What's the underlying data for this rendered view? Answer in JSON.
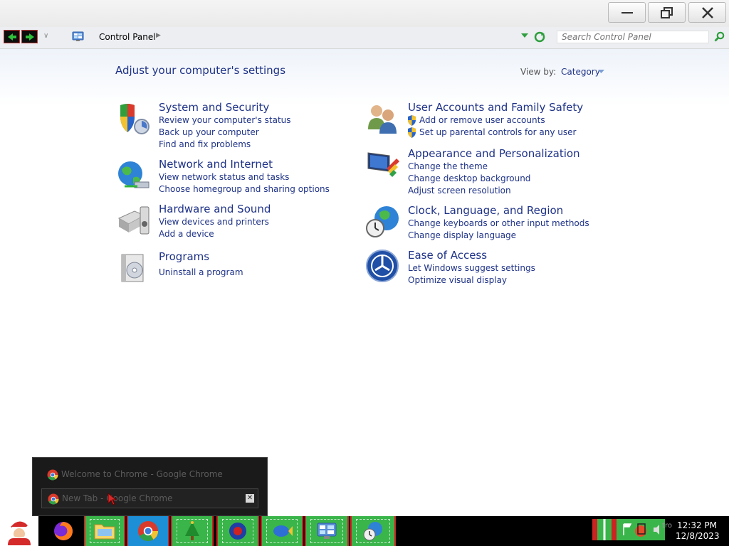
{
  "address": {
    "crumb": "Control Panel",
    "search_placeholder": "Search Control Panel"
  },
  "header": {
    "heading": "Adjust your computer's settings",
    "view_by_label": "View by:",
    "view_by_value": "Category"
  },
  "categories": [
    {
      "title": "System and Security",
      "links": [
        "Review your computer's status",
        "Back up your computer",
        "Find and fix problems"
      ]
    },
    {
      "title": "Network and Internet",
      "links": [
        "View network status and tasks",
        "Choose homegroup and sharing options"
      ]
    },
    {
      "title": "Hardware and Sound",
      "links": [
        "View devices and printers",
        "Add a device"
      ]
    },
    {
      "title": "Programs",
      "links": [
        "Uninstall a program"
      ]
    },
    {
      "title": "User Accounts and Family Safety",
      "links": [
        "Add or remove user accounts",
        "Set up parental controls for any user"
      ]
    },
    {
      "title": "Appearance and Personalization",
      "links": [
        "Change the theme",
        "Change desktop background",
        "Adjust screen resolution"
      ]
    },
    {
      "title": "Clock, Language, and Region",
      "links": [
        "Change keyboards or other input methods",
        "Change display language"
      ]
    },
    {
      "title": "Ease of Access",
      "links": [
        "Let Windows suggest settings",
        "Optimize visual display"
      ]
    }
  ],
  "thumbnails": [
    {
      "label": "Welcome to Chrome - Google Chrome"
    },
    {
      "label": "New Tab - Google Chrome"
    }
  ],
  "taskbar": {
    "tray_text": "tro",
    "time": "12:32 PM",
    "date": "12/8/2023"
  },
  "colors": {
    "link_blue": "#1e3287",
    "taskbar_green": "#3ab54a",
    "taskbar_red": "#cc2222"
  }
}
